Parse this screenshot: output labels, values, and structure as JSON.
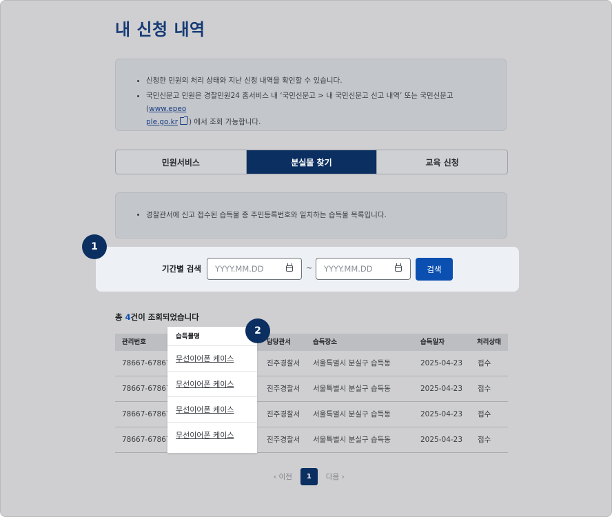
{
  "page": {
    "title": "내 신청 내역"
  },
  "info": {
    "line1": "신청한 민원의 처리 상태와 지난 신청 내역을 확인할 수 있습니다.",
    "line2_prefix": "국민신문고 민원은 경찰민원24 홈서비스 내 ‘국민신문고 > 내 국민신문고 신고 내역’ 또는 국민신문고 (",
    "line2_link_a": "www.epeo",
    "line2_link_b": "ple.go.kr",
    "line2_suffix": ") 에서 조회 가능합니다."
  },
  "tabs": [
    {
      "label": "민원서비스",
      "active": false
    },
    {
      "label": "분실물 찾기",
      "active": true
    },
    {
      "label": "교육 신청",
      "active": false
    }
  ],
  "notice": {
    "text": "경찰관서에 신고 접수된 습득물 중 주민등록번호와 일치하는 습득물 목록입니다."
  },
  "search": {
    "label": "기간별 검색",
    "from_placeholder": "YYYY.MM.DD",
    "to_placeholder": "YYYY.MM.DD",
    "separator": "~",
    "button": "검색"
  },
  "badges": {
    "one": "1",
    "two": "2"
  },
  "results": {
    "prefix": "총 ",
    "count": "4",
    "suffix": "건이 조회되었습니다"
  },
  "table": {
    "headers": {
      "no": "관리번호",
      "item": "습득물명",
      "office": "담당관서",
      "place": "습득장소",
      "date": "습득일자",
      "status": "처리상태"
    },
    "rows": [
      {
        "no": "78667-67867",
        "item": "무선이어폰 케이스",
        "office": "진주경찰서",
        "place": "서울특별시 분실구 습득동",
        "date": "2025-04-23",
        "status": "접수"
      },
      {
        "no": "78667-67867",
        "item": "무선이어폰 케이스",
        "office": "진주경찰서",
        "place": "서울특별시 분실구 습득동",
        "date": "2025-04-23",
        "status": "접수"
      },
      {
        "no": "78667-67867",
        "item": "무선이어폰 케이스",
        "office": "진주경찰서",
        "place": "서울특별시 분실구 습득동",
        "date": "2025-04-23",
        "status": "접수"
      },
      {
        "no": "78667-67867",
        "item": "무선이어폰 케이스",
        "office": "진주경찰서",
        "place": "서울특별시 분실구 습득동",
        "date": "2025-04-23",
        "status": "접수"
      }
    ]
  },
  "pagination": {
    "prev": "이전",
    "current": "1",
    "next": "다음"
  },
  "icons": {
    "prev": "chevron-left-icon",
    "next": "chevron-right-icon",
    "calendar": "calendar-icon",
    "external": "external-link-icon"
  }
}
